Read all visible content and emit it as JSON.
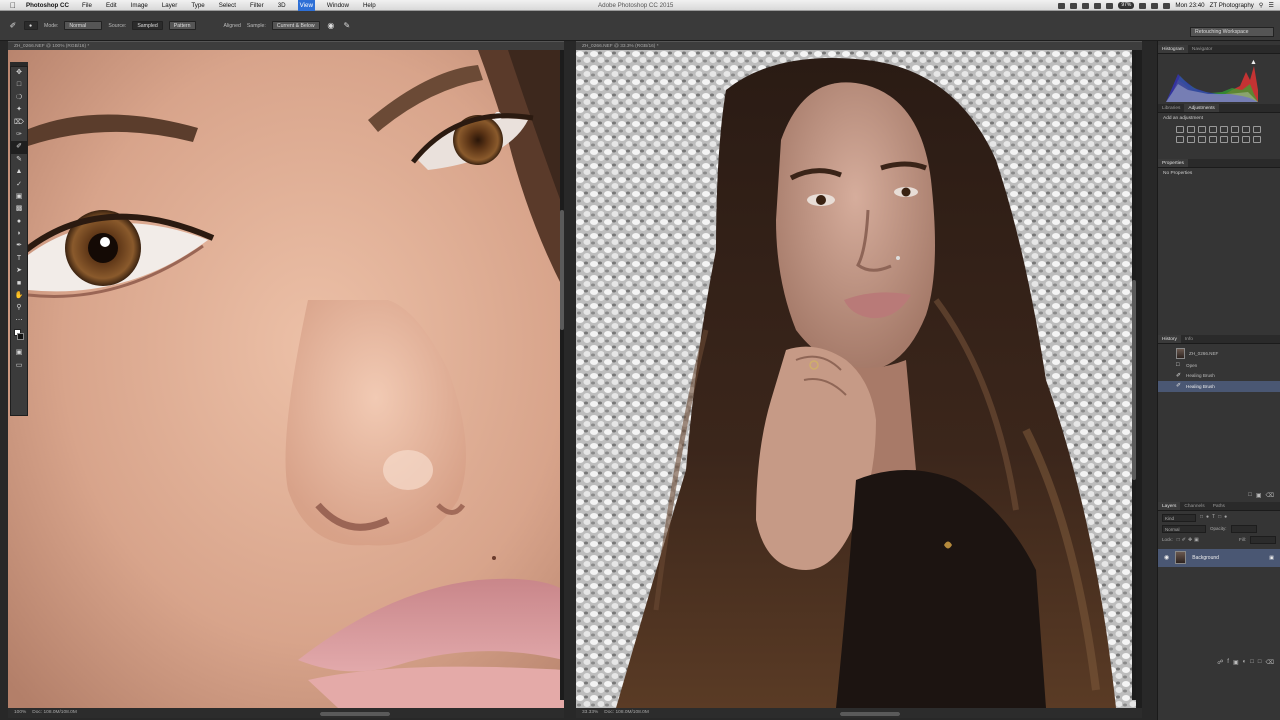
{
  "menubar": {
    "app_name": "Photoshop CC",
    "items": [
      "File",
      "Edit",
      "Image",
      "Layer",
      "Type",
      "Select",
      "Filter",
      "3D",
      "View",
      "Window",
      "Help"
    ],
    "active_item": "View",
    "window_title": "Adobe Photoshop CC 2015",
    "clock": "Mon 23:40",
    "user": "ZT Photography",
    "battery_pill": "97%"
  },
  "options": {
    "mode_label": "Mode:",
    "mode_value": "Normal",
    "source_label": "Source:",
    "source_sampled": "Sampled",
    "source_pattern": "Pattern",
    "aligned_label": "Aligned",
    "sample_label": "Sample:",
    "sample_value": "Current & Below",
    "workspace": "Retouching Workspace"
  },
  "documents": {
    "left_tab": "ZH_0266.NEF @ 100% (RGB/16) *",
    "right_tab": "ZH_0266.NEF @ 33.3% (RGB/16) *",
    "left_zoom": "100%",
    "left_doc": "Doc: 108.0M/108.0M",
    "right_zoom": "33.33%",
    "right_doc": "Doc: 108.0M/108.0M"
  },
  "tools": [
    "move",
    "marquee",
    "lasso",
    "quick-select",
    "crop",
    "eyedropper",
    "healing",
    "brush",
    "clone",
    "history",
    "eraser",
    "gradient",
    "blur",
    "dodge",
    "pen",
    "type",
    "path-select",
    "shape",
    "hand",
    "zoom"
  ],
  "panels": {
    "histogram_tabs": [
      "Histogram",
      "Navigator"
    ],
    "adjust_tabs": [
      "Libraries",
      "Adjustments"
    ],
    "adjust_title": "Add an adjustment",
    "properties_tab": "Properties",
    "properties_text": "No Properties",
    "history_tabs": [
      "History",
      "Info"
    ],
    "history_doc": "ZH_0266.NEF",
    "history_items": [
      "Open",
      "Healing Brush",
      "Healing Brush"
    ],
    "layers_tabs": [
      "Layers",
      "Channels",
      "Paths"
    ],
    "layers_kind": "Kind",
    "layers_mode": "Normal",
    "layers_opacity_label": "Opacity:",
    "layers_lock_label": "Lock:",
    "layers_fill_label": "Fill:",
    "layer_name": "Background"
  },
  "colors": {
    "ui_dark": "#282828",
    "panel": "#353535",
    "selection": "#4a5773",
    "menu_active": "#2d6fd6"
  }
}
